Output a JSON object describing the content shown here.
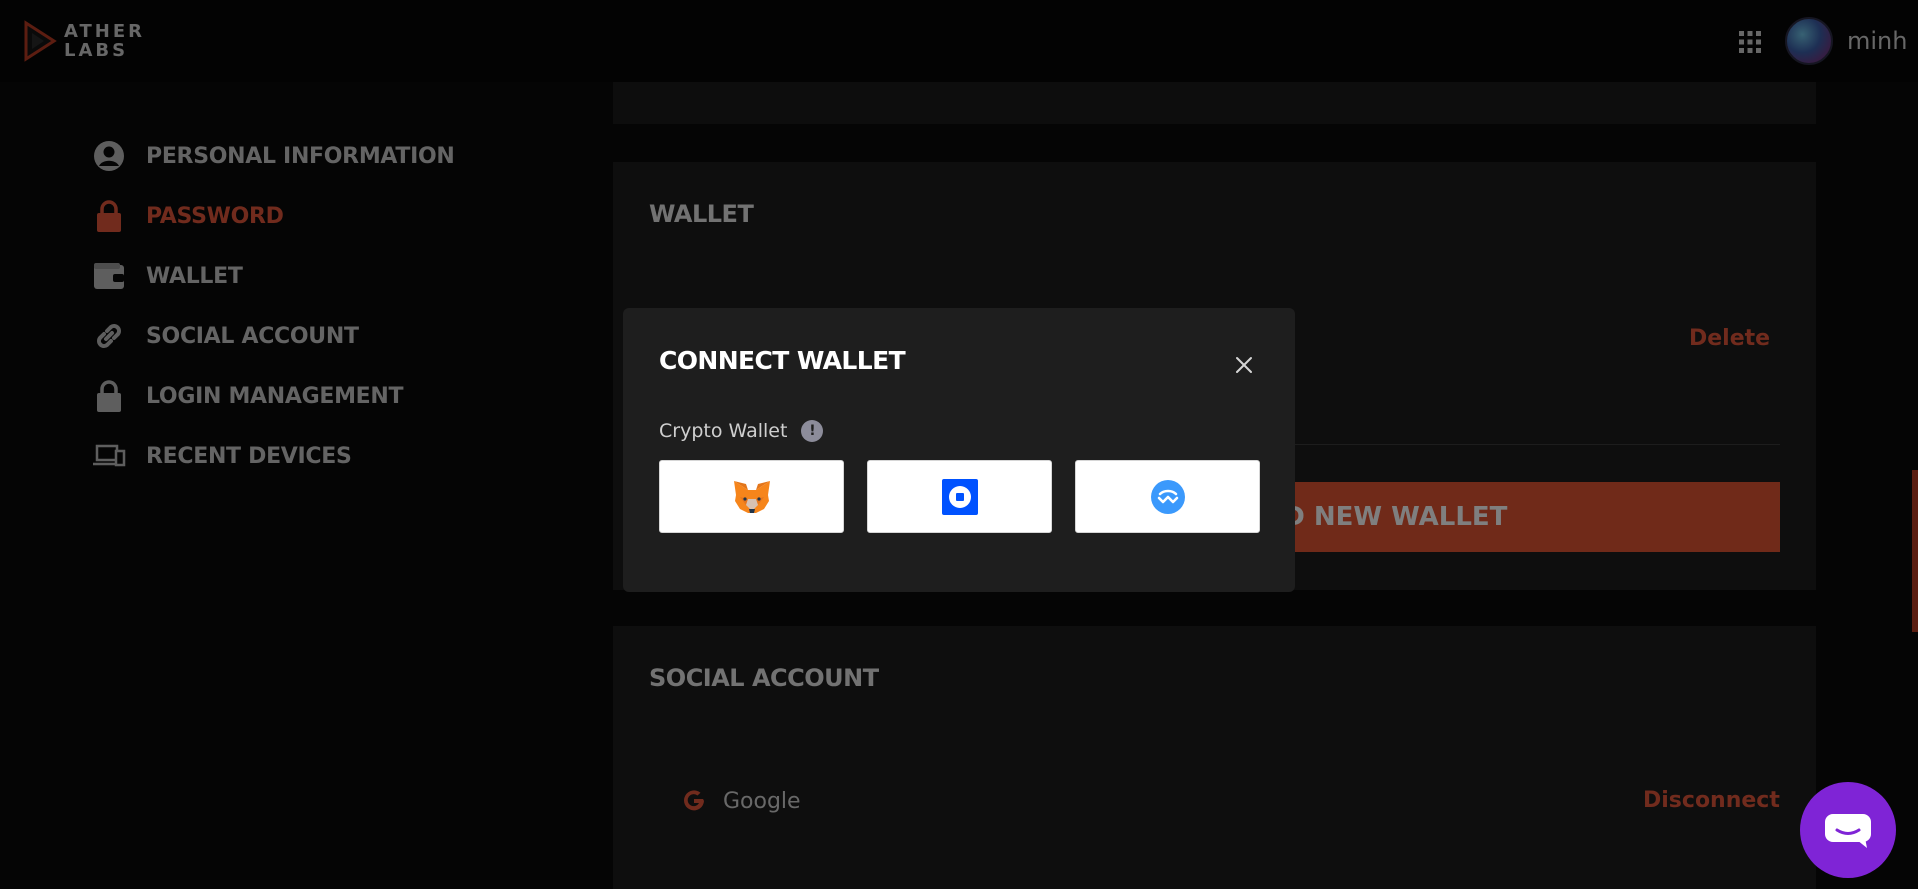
{
  "brand": {
    "line1": "ATHER",
    "line2": "LABS"
  },
  "header": {
    "username": "minh"
  },
  "sidebar": {
    "items": [
      {
        "label": "PERSONAL INFORMATION",
        "icon": "user-circle-icon"
      },
      {
        "label": "PASSWORD",
        "icon": "lock-icon",
        "active": true
      },
      {
        "label": "WALLET",
        "icon": "wallet-icon"
      },
      {
        "label": "SOCIAL ACCOUNT",
        "icon": "link-icon"
      },
      {
        "label": "LOGIN MANAGEMENT",
        "icon": "lock-icon"
      },
      {
        "label": "RECENT DEVICES",
        "icon": "devices-icon"
      }
    ]
  },
  "wallet_section": {
    "title": "WALLET",
    "delete_label": "Delete",
    "add_button_label": "ADD NEW WALLET"
  },
  "social_section": {
    "title": "SOCIAL ACCOUNT",
    "account_name": "Google",
    "disconnect_label": "Disconnect"
  },
  "modal": {
    "title": "CONNECT WALLET",
    "crypto_label": "Crypto Wallet",
    "info_symbol": "!",
    "options": [
      {
        "icon": "metamask-fox-icon"
      },
      {
        "icon": "coinbase-icon"
      },
      {
        "icon": "walletconnect-icon"
      }
    ]
  },
  "colors": {
    "accent": "#e2563a",
    "button": "#e05533",
    "chat": "#7f24d6",
    "coinbase": "#0052ff",
    "walletconnect": "#3b99fc"
  }
}
